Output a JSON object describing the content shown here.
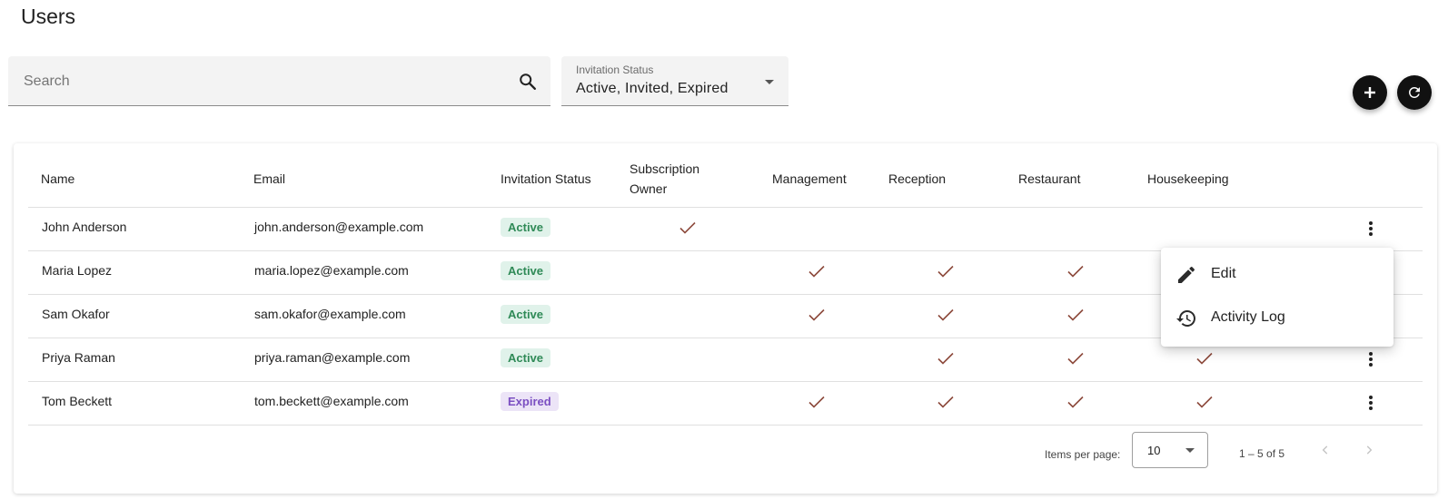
{
  "page": {
    "title": "Users"
  },
  "search": {
    "placeholder": "Search",
    "value": ""
  },
  "filter": {
    "label": "Invitation Status",
    "value": "Active, Invited, Expired"
  },
  "colors": {
    "accent": "#111111",
    "check": "#8d4a3c",
    "active_bg": "#e0f2ea",
    "active_text": "#2f8a57",
    "expired_bg": "#ece4f7",
    "expired_text": "#7b4fc2"
  },
  "table": {
    "columns": {
      "name": "Name",
      "email": "Email",
      "status": "Invitation Status",
      "sub_owner_1": "Subscription",
      "sub_owner_2": "Owner",
      "management": "Management",
      "reception": "Reception",
      "restaurant": "Restaurant",
      "housekeeping": "Housekeeping"
    },
    "rows": [
      {
        "name": "John Anderson",
        "email": "john.anderson@example.com",
        "status": "Active",
        "owner": true,
        "management": false,
        "reception": false,
        "restaurant": false,
        "housekeeping": false
      },
      {
        "name": "Maria Lopez",
        "email": "maria.lopez@example.com",
        "status": "Active",
        "owner": false,
        "management": true,
        "reception": true,
        "restaurant": true,
        "housekeeping": false
      },
      {
        "name": "Sam Okafor",
        "email": "sam.okafor@example.com",
        "status": "Active",
        "owner": false,
        "management": true,
        "reception": true,
        "restaurant": true,
        "housekeeping": false
      },
      {
        "name": "Priya Raman",
        "email": "priya.raman@example.com",
        "status": "Active",
        "owner": false,
        "management": false,
        "reception": true,
        "restaurant": true,
        "housekeeping": true
      },
      {
        "name": "Tom Beckett",
        "email": "tom.beckett@example.com",
        "status": "Expired",
        "owner": false,
        "management": true,
        "reception": true,
        "restaurant": true,
        "housekeeping": true
      }
    ]
  },
  "paginator": {
    "items_per_page_label": "Items per page:",
    "page_size": "10",
    "range": "1 – 5 of 5"
  },
  "context_menu": {
    "items": [
      {
        "label": "Edit",
        "icon": "pencil-icon"
      },
      {
        "label": "Activity Log",
        "icon": "history-icon"
      }
    ]
  },
  "icons": {
    "search": "search-icon",
    "add": "plus-icon",
    "refresh": "refresh-icon",
    "more": "more-vert-icon",
    "check": "check-icon",
    "prev": "chevron-left-icon",
    "next": "chevron-right-icon"
  }
}
